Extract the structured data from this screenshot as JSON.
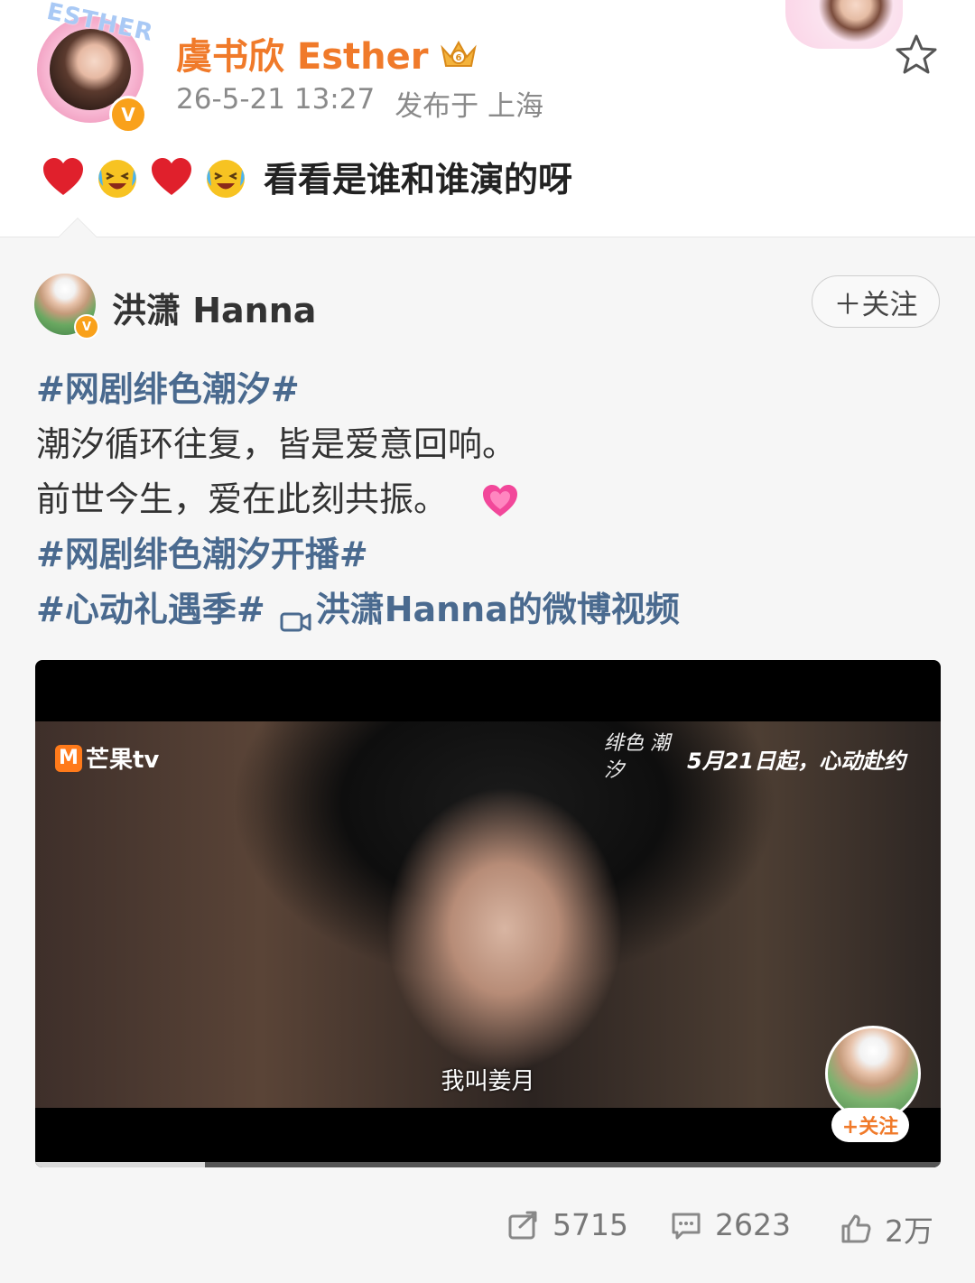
{
  "author": {
    "name": "虞书欣 Esther",
    "frame_text": "ESTHER",
    "verified_mark": "V",
    "time": "26-5-21 13:27",
    "location": "发布于 上海",
    "post_text": "看看是谁和谁演的呀",
    "emojis": [
      "red-heart",
      "crying-laughing-face",
      "red-heart",
      "crying-laughing-face"
    ]
  },
  "repost": {
    "author_name": "洪潇 Hanna",
    "verified_mark": "V",
    "follow_label": "＋关注",
    "topic_1": "#网剧绯色潮汐#",
    "line_1": "潮汐循环往复，皆是爱意回响。",
    "line_2": "前世今生，爱在此刻共振。",
    "topic_2": "#网剧绯色潮汐开播#",
    "topic_3": "#心动礼遇季#",
    "video_link": "洪潇Hanna的微博视频"
  },
  "video": {
    "logo_mark": "M",
    "logo_text": "芒果tv",
    "drama_logo": "绯色 潮汐",
    "premiere_text": "5月21日起，心动赴约",
    "subtitle": "我叫姜月",
    "follow_label": "+关注",
    "progress": 0.187
  },
  "actions": {
    "repost_count": "5715",
    "comment_count": "2623",
    "like_count": "2万"
  },
  "colors": {
    "author_name": "#f07a2a",
    "topic": "#4a6a8f",
    "card_bg": "#f6f6f6",
    "verified": "#f9a11b"
  }
}
